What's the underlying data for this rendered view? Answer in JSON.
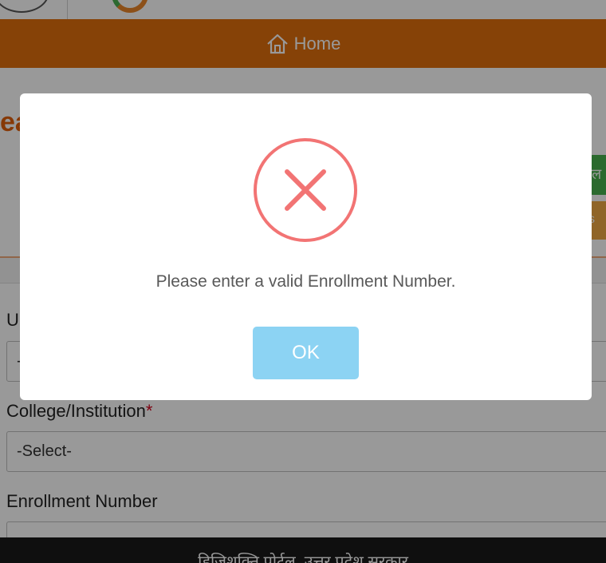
{
  "header": {
    "nav_home_label": "Home",
    "heading_fragment": "ea"
  },
  "side_buttons": {
    "green_label": "ल",
    "orange_label": "s"
  },
  "form": {
    "field_1_label_fragment": "U",
    "field_1_value_fragment": "-",
    "college_label": "College/Institution",
    "required_marker": "*",
    "college_value": "-Select-",
    "enrollment_label": "Enrollment Number",
    "enrollment_value": ""
  },
  "footer": {
    "text": "डिजिशक्ति पोर्टल, उत्तर प्रदेश सरकार"
  },
  "dialog": {
    "icon": "error-x-icon",
    "message": "Please enter a valid Enrollment Number.",
    "ok_label": "OK"
  },
  "colors": {
    "navbar": "#e06e0c",
    "error_icon": "#f27474",
    "ok_button": "#8cd3f3",
    "footer": "#1a1a1a"
  }
}
